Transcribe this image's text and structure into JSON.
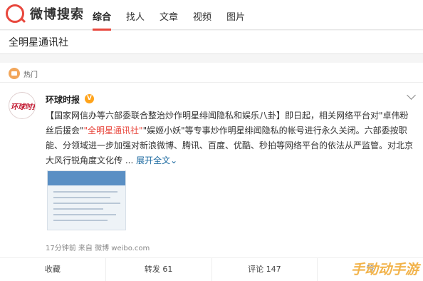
{
  "header": {
    "logo_text": "微博搜索",
    "tabs": [
      {
        "label": "综合",
        "active": true
      },
      {
        "label": "找人",
        "active": false
      },
      {
        "label": "文章",
        "active": false
      },
      {
        "label": "视频",
        "active": false
      },
      {
        "label": "图片",
        "active": false
      }
    ]
  },
  "search": {
    "value": "全明星通讯社"
  },
  "card": {
    "section_label": "热门",
    "author": "环球时报",
    "avatar_text": "环球时报",
    "verified_badge": "V",
    "post": {
      "text_1": "【国家网信办等六部委联合整治炒作明星绯闻隐私和娱乐八卦】即日起，相关网络平台对\"卓伟粉丝后援会\"",
      "highlight": "\"全明星通讯社\"",
      "text_2": "\"娱姬小妖\"等专事炒作明星绯闻隐私的帐号进行永久关闭。六部委按职能、分领域进一步加强对新浪微博、腾讯、百度、优酷、秒拍等网络平台的依法从严监管。对北京大风行锐角度文化传 ...",
      "expand_label": "展开全文"
    },
    "meta": "17分钟前 来自 微博 weibo.com",
    "actions": [
      {
        "label": "收藏"
      },
      {
        "label": "转发 61"
      },
      {
        "label": "评论 147"
      },
      {
        "label": "赞"
      }
    ]
  },
  "watermark": "手动动手游",
  "colors": {
    "accent": "#e8473d",
    "link": "#1c6aa0",
    "verified": "#ffa31a"
  }
}
